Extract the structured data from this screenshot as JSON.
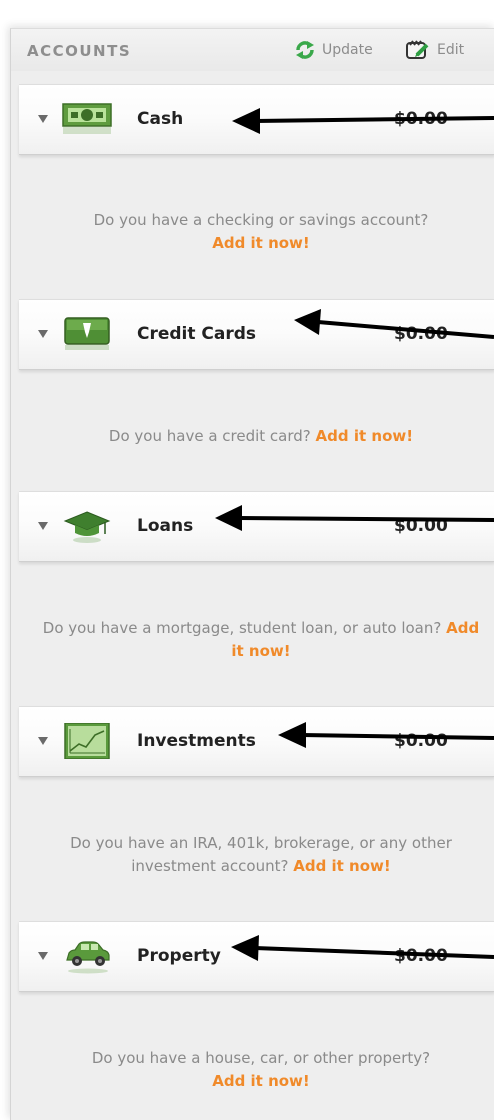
{
  "toolbar": {
    "title": "ACCOUNTS",
    "update_label": "Update",
    "edit_label": "Edit"
  },
  "sections": [
    {
      "title": "Cash",
      "amount": "$0.00",
      "icon": "cash-icon",
      "prompt": "Do you have a checking or savings account?",
      "link": "Add it now!"
    },
    {
      "title": "Credit Cards",
      "amount": "$0.00",
      "icon": "credit-card-icon",
      "prompt": "Do you have a credit card?",
      "link": "Add it now!"
    },
    {
      "title": "Loans",
      "amount": "$0.00",
      "icon": "graduation-cap-icon",
      "prompt": "Do you have a mortgage, student loan, or auto loan?",
      "link": "Add it now!"
    },
    {
      "title": "Investments",
      "amount": "$0.00",
      "icon": "investment-chart-icon",
      "prompt": "Do you have an IRA, 401k, brokerage, or any other investment account?",
      "link": "Add it now!"
    },
    {
      "title": "Property",
      "amount": "$0.00",
      "icon": "car-icon",
      "prompt": "Do you have a house, car, or other property?",
      "link": "Add it now!"
    }
  ],
  "colors": {
    "link": "#f08a2a",
    "icon_green": "#5a9a3c",
    "panel_bg": "#eeeeee"
  }
}
